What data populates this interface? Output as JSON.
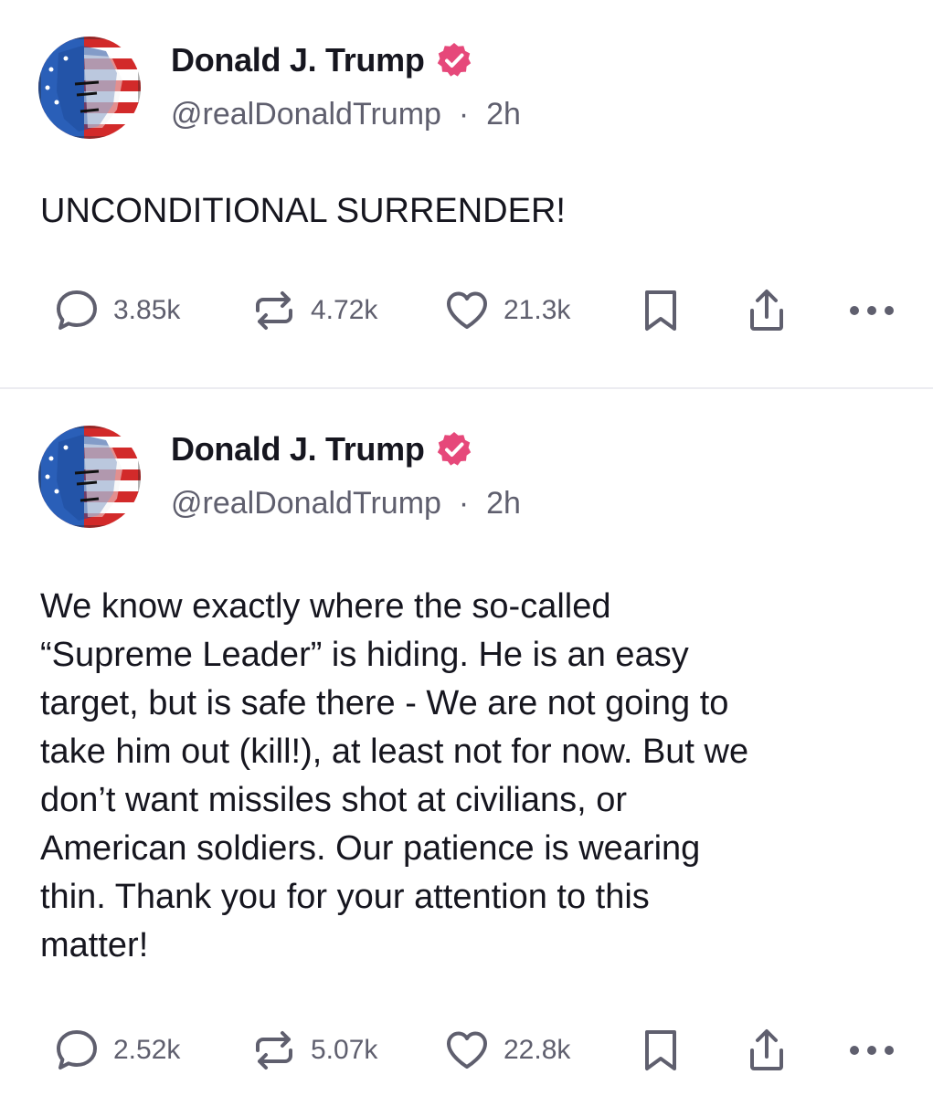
{
  "posts": [
    {
      "author": {
        "name": "Donald J. Trump",
        "handle": "@realDonaldTrump",
        "separator": "·",
        "time": "2h",
        "verified_icon": "verified-badge-icon"
      },
      "text": "UNCONDITIONAL SURRENDER!",
      "stats": {
        "replies": "3.85k",
        "reposts": "4.72k",
        "likes": "21.3k"
      }
    },
    {
      "author": {
        "name": "Donald J. Trump",
        "handle": "@realDonaldTrump",
        "separator": "·",
        "time": "2h",
        "verified_icon": "verified-badge-icon"
      },
      "text": "We know exactly where the so-called\n“Supreme Leader” is hiding. He is an easy\ntarget, but is safe there - We are not going to\ntake him out (kill!), at least not for now. But we\ndon’t want missiles shot at civilians, or\nAmerican soldiers. Our patience is wearing\nthin. Thank you for your attention to this\nmatter!",
      "stats": {
        "replies": "2.52k",
        "reposts": "5.07k",
        "likes": "22.8k"
      }
    }
  ],
  "icons": {
    "reply": "reply-icon",
    "repost": "repost-icon",
    "like": "heart-icon",
    "bookmark": "bookmark-icon",
    "share": "share-icon",
    "more": "more-icon"
  },
  "colors": {
    "text": "#16161f",
    "muted": "#5f5f6e",
    "verified": "#e6487a",
    "divider": "#ececf1"
  }
}
